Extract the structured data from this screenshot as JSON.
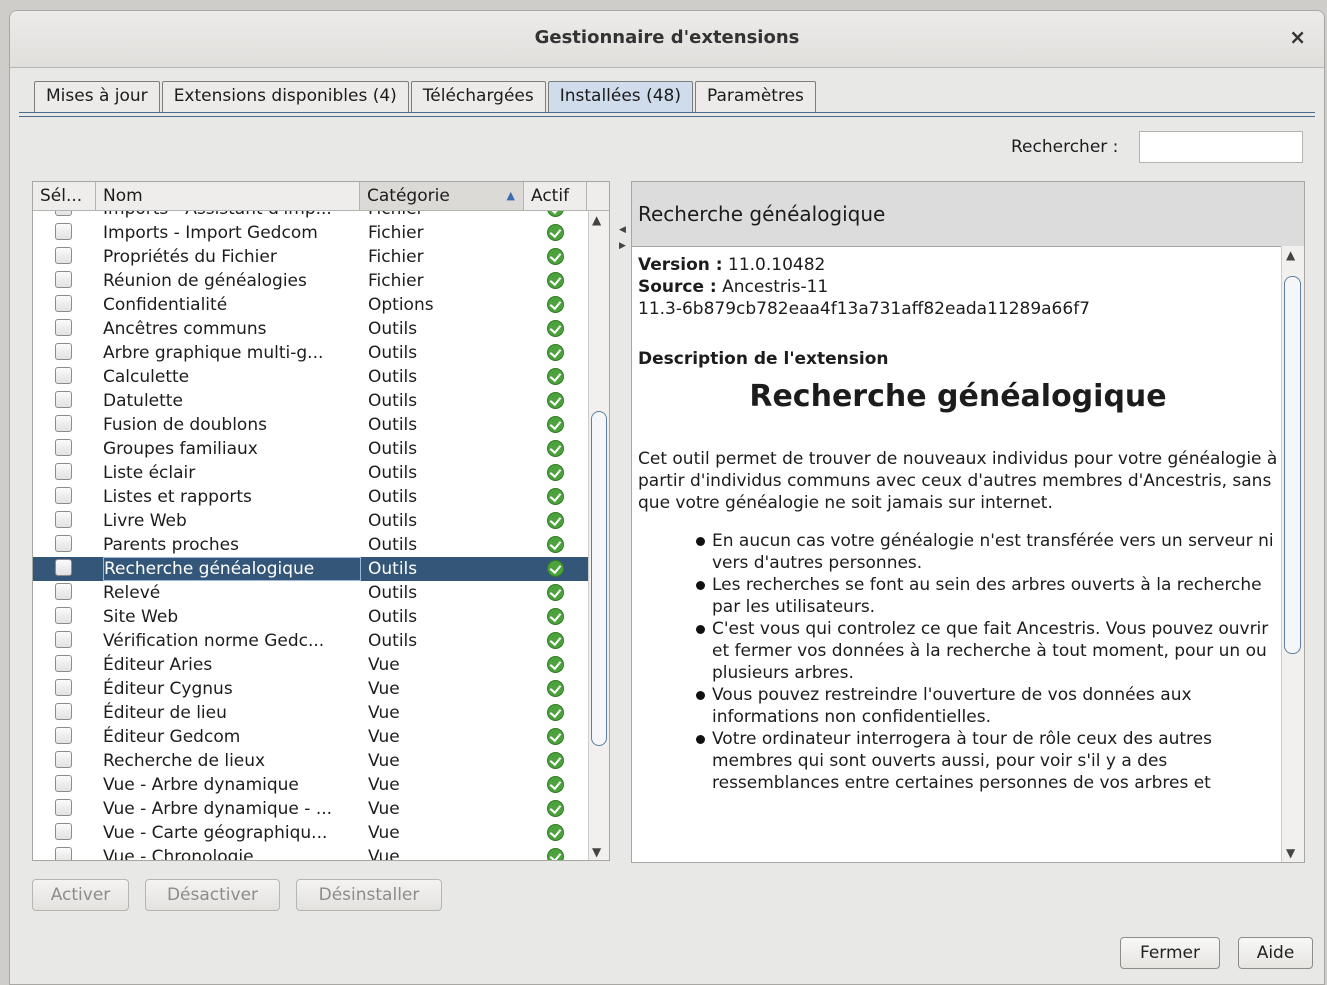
{
  "window": {
    "title": "Gestionnaire d'extensions",
    "close_icon": "×"
  },
  "tabs": [
    "Mises à jour",
    "Extensions disponibles (4)",
    "Téléchargées",
    "Installées (48)",
    "Paramètres"
  ],
  "active_tab": 3,
  "search": {
    "label": "Rechercher :",
    "value": ""
  },
  "table": {
    "columns": [
      "Sél...",
      "Nom",
      "Catégorie",
      "Actif"
    ],
    "sort_icon": "▲",
    "partial_top": {
      "name": "Imports - Assistant d'imp...",
      "category": "Fichier"
    },
    "rows": [
      {
        "name": "Imports - Import Gedcom",
        "category": "Fichier",
        "selected": false,
        "active": true
      },
      {
        "name": "Propriétés du Fichier",
        "category": "Fichier",
        "selected": false,
        "active": true
      },
      {
        "name": "Réunion de généalogies",
        "category": "Fichier",
        "selected": false,
        "active": true
      },
      {
        "name": "Confidentialité",
        "category": "Options",
        "selected": false,
        "active": true
      },
      {
        "name": "Ancêtres communs",
        "category": "Outils",
        "selected": false,
        "active": true
      },
      {
        "name": "Arbre graphique multi-g...",
        "category": "Outils",
        "selected": false,
        "active": true
      },
      {
        "name": "Calculette",
        "category": "Outils",
        "selected": false,
        "active": true
      },
      {
        "name": "Datulette",
        "category": "Outils",
        "selected": false,
        "active": true
      },
      {
        "name": "Fusion de doublons",
        "category": "Outils",
        "selected": false,
        "active": true
      },
      {
        "name": "Groupes familiaux",
        "category": "Outils",
        "selected": false,
        "active": true
      },
      {
        "name": "Liste éclair",
        "category": "Outils",
        "selected": false,
        "active": true
      },
      {
        "name": "Listes et rapports",
        "category": "Outils",
        "selected": false,
        "active": true
      },
      {
        "name": "Livre Web",
        "category": "Outils",
        "selected": false,
        "active": true
      },
      {
        "name": "Parents proches",
        "category": "Outils",
        "selected": false,
        "active": true
      },
      {
        "name": "Recherche généalogique",
        "category": "Outils",
        "selected": true,
        "active": true
      },
      {
        "name": "Relevé",
        "category": "Outils",
        "selected": false,
        "active": true
      },
      {
        "name": "Site Web",
        "category": "Outils",
        "selected": false,
        "active": true
      },
      {
        "name": "Vérification norme Gedc...",
        "category": "Outils",
        "selected": false,
        "active": true
      },
      {
        "name": "Éditeur Aries",
        "category": "Vue",
        "selected": false,
        "active": true
      },
      {
        "name": "Éditeur Cygnus",
        "category": "Vue",
        "selected": false,
        "active": true
      },
      {
        "name": "Éditeur de lieu",
        "category": "Vue",
        "selected": false,
        "active": true
      },
      {
        "name": "Éditeur Gedcom",
        "category": "Vue",
        "selected": false,
        "active": true
      },
      {
        "name": "Recherche de lieux",
        "category": "Vue",
        "selected": false,
        "active": true
      },
      {
        "name": "Vue - Arbre dynamique",
        "category": "Vue",
        "selected": false,
        "active": true
      },
      {
        "name": "Vue - Arbre dynamique - ...",
        "category": "Vue",
        "selected": false,
        "active": true
      },
      {
        "name": "Vue - Carte géographiqu...",
        "category": "Vue",
        "selected": false,
        "active": true
      },
      {
        "name": "Vue - Chronologie",
        "category": "Vue",
        "selected": false,
        "active": true
      }
    ]
  },
  "detail": {
    "header": "Recherche généalogique",
    "version_label": "Version :",
    "version_value": "11.0.10482",
    "source_label": "Source :",
    "source_value": "Ancestris-11",
    "source_hash": "11.3-6b879cb782eaa4f13a731aff82eada11289a66f7",
    "desc_heading": "Description de l'extension",
    "big_title": "Recherche généalogique",
    "paragraph": "Cet outil permet de trouver de nouveaux individus pour votre généalogie à partir d'individus communs avec ceux d'autres membres d'Ancestris, sans que votre généalogie ne soit jamais sur internet.",
    "bullets": [
      "En aucun cas votre généalogie n'est transférée vers un serveur ni vers d'autres personnes.",
      "Les recherches se font au sein des arbres ouverts à la recherche par les utilisateurs.",
      "C'est vous qui controlez ce que fait Ancestris. Vous pouvez ouvrir et fermer vos données à la recherche à tout moment, pour un ou plusieurs arbres.",
      "Vous pouvez restreindre l'ouverture de vos données aux informations non confidentielles.",
      "Votre ordinateur interrogera à tour de rôle ceux des autres membres qui sont ouverts aussi, pour voir s'il y a des ressemblances entre certaines personnes de vos arbres et"
    ]
  },
  "buttons": {
    "activate": "Activer",
    "deactivate": "Désactiver",
    "uninstall": "Désinstaller",
    "close": "Fermer",
    "help": "Aide"
  }
}
